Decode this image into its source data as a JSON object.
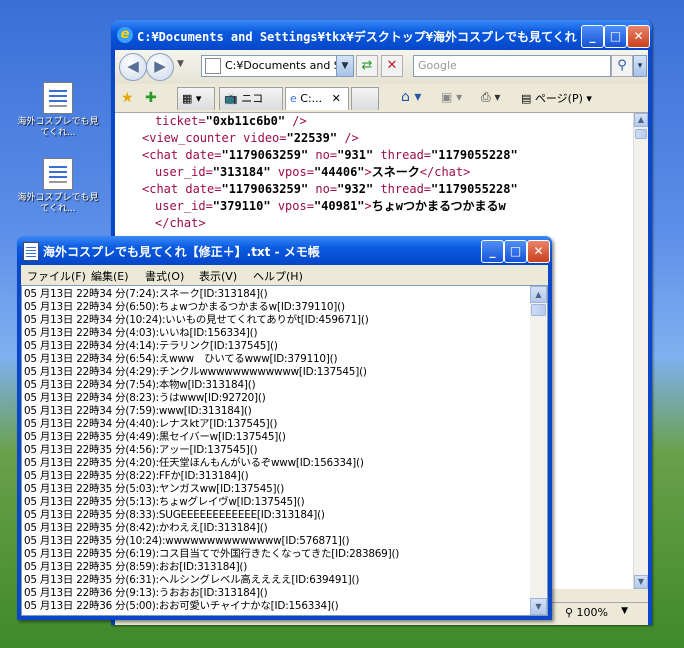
{
  "desktop": {
    "icons": [
      {
        "label": "海外コスプレでも見てくれ..."
      },
      {
        "label": "海外コスプレでも見てくれ..."
      }
    ]
  },
  "ie": {
    "title": "C:¥Documents and Settings¥tkx¥デスクトップ¥海外コスプレでも見てくれ...",
    "address": "C:¥Documents and Se",
    "search_placeholder": "Google",
    "tabs": [
      {
        "label": "ニコニ..."
      },
      {
        "label": "C:..."
      }
    ],
    "toolbar_page": "ページ(P)",
    "zoom": "100%",
    "xml_lines": [
      {
        "indent": 4,
        "parts": [
          {
            "c": "att",
            "t": "ticket="
          },
          {
            "c": "val",
            "t": "\"0xb11c6b0\""
          },
          {
            "c": "tag",
            "t": " />"
          }
        ]
      },
      {
        "indent": 3,
        "parts": [
          {
            "c": "tag",
            "t": "<view_counter "
          },
          {
            "c": "att",
            "t": "video="
          },
          {
            "c": "val",
            "t": "\"22539\""
          },
          {
            "c": "tag",
            "t": " />"
          }
        ]
      },
      {
        "indent": 3,
        "parts": [
          {
            "c": "tag",
            "t": "<chat "
          },
          {
            "c": "att",
            "t": "date="
          },
          {
            "c": "val",
            "t": "\"1179063259\""
          },
          {
            "c": "att",
            "t": " no="
          },
          {
            "c": "val",
            "t": "\"931\""
          },
          {
            "c": "att",
            "t": " thread="
          },
          {
            "c": "val",
            "t": "\"1179055228\""
          }
        ]
      },
      {
        "indent": 4,
        "parts": [
          {
            "c": "att",
            "t": "user_id="
          },
          {
            "c": "val",
            "t": "\"313184\""
          },
          {
            "c": "att",
            "t": " vpos="
          },
          {
            "c": "val",
            "t": "\"44406\""
          },
          {
            "c": "tag",
            "t": ">"
          },
          {
            "c": "val",
            "t": "スネーク"
          },
          {
            "c": "tag",
            "t": "</chat>"
          }
        ]
      },
      {
        "indent": 3,
        "parts": [
          {
            "c": "tag",
            "t": "<chat "
          },
          {
            "c": "att",
            "t": "date="
          },
          {
            "c": "val",
            "t": "\"1179063259\""
          },
          {
            "c": "att",
            "t": " no="
          },
          {
            "c": "val",
            "t": "\"932\""
          },
          {
            "c": "att",
            "t": " thread="
          },
          {
            "c": "val",
            "t": "\"1179055228\""
          }
        ]
      },
      {
        "indent": 4,
        "parts": [
          {
            "c": "att",
            "t": "user_id="
          },
          {
            "c": "val",
            "t": "\"379110\""
          },
          {
            "c": "att",
            "t": " vpos="
          },
          {
            "c": "val",
            "t": "\"40981\""
          },
          {
            "c": "tag",
            "t": ">"
          },
          {
            "c": "val",
            "t": "ちょwつかまるつかまるw"
          }
        ]
      },
      {
        "indent": 4,
        "parts": [
          {
            "c": "tag",
            "t": "</chat>"
          }
        ]
      }
    ]
  },
  "notepad": {
    "title": "海外コスプレでも見てくれ【修正＋】.txt - メモ帳",
    "menu": [
      "ファイル(F)",
      "編集(E)",
      "書式(O)",
      "表示(V)",
      "ヘルプ(H)"
    ],
    "lines": [
      "05 月13日 22時34 分(7:24):スネーク[ID:313184]()",
      "05 月13日 22時34 分(6:50):ちょwつかまるつかまるw[ID:379110]()",
      "05 月13日 22時34 分(10:24):いいもの見せてくれてありがt[ID:459671]()",
      "05 月13日 22時34 分(4:03):いいね[ID:156334]()",
      "05 月13日 22時34 分(4:14):テラリンク[ID:137545]()",
      "05 月13日 22時34 分(6:54):えwww　ひいてるwww[ID:379110]()",
      "05 月13日 22時34 分(4:29):チンクルwwwwwwwwwwww[ID:137545]()",
      "05 月13日 22時34 分(7:54):本物w[ID:313184]()",
      "05 月13日 22時34 分(8:23):うはwww[ID:92720]()",
      "05 月13日 22時34 分(7:59):www[ID:313184]()",
      "05 月13日 22時34 分(4:40):レナスktア[ID:137545]()",
      "05 月13日 22時35 分(4:49):黒セイバーw[ID:137545]()",
      "05 月13日 22時35 分(4:56):アッー[ID:137545]()",
      "05 月13日 22時35 分(4:20):任天堂ほんもんがいるぞwww[ID:156334]()",
      "05 月13日 22時35 分(8:22):FFか[ID:313184]()",
      "05 月13日 22時35 分(5:03):ヤンガスww[ID:137545]()",
      "05 月13日 22時35 分(5:13):ちょwグレイヴw[ID:137545]()",
      "05 月13日 22時35 分(8:33):SUGEEEEEEEEEEEE[ID:313184]()",
      "05 月13日 22時35 分(8:42):かわええ[ID:313184]()",
      "05 月13日 22時35 分(10:24):wwwwwwwwwwwwww[ID:576871]()",
      "05 月13日 22時35 分(6:19):コス目当てで外国行きたくなってきた[ID:283869]()",
      "05 月13日 22時35 分(8:59):おお[ID:313184]()",
      "05 月13日 22時35 分(6:31):ヘルシングレベル高ええええ[ID:639491]()",
      "05 月13日 22時36 分(9:13):うおおお[ID:313184]()",
      "05 月13日 22時36 分(5:00):おお可愛いチャイナかな[ID:156334]()"
    ]
  }
}
